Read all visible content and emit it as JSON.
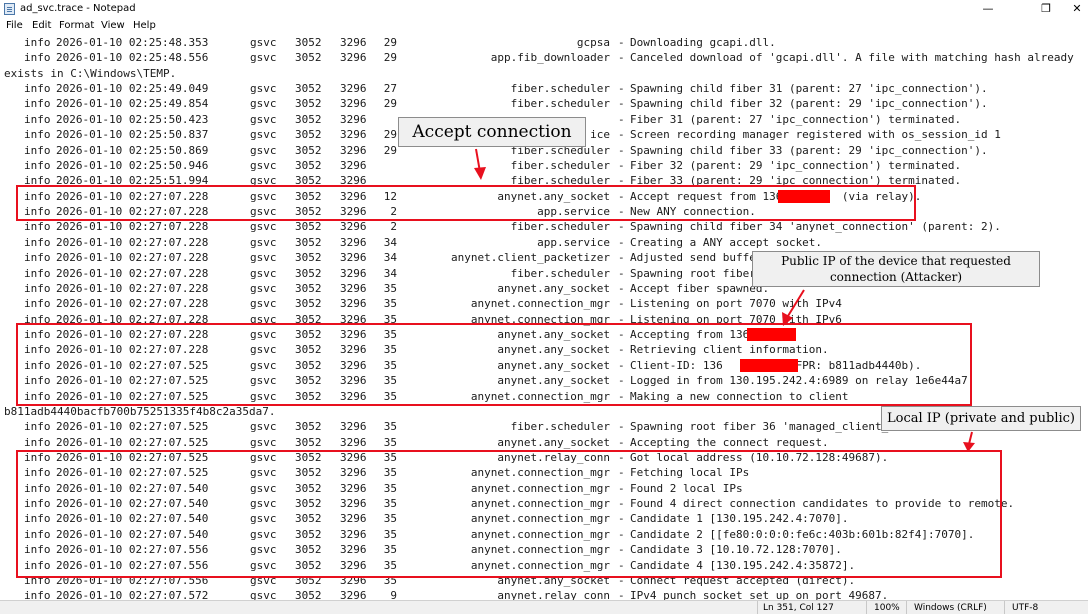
{
  "window": {
    "title": "ad_svc.trace - Notepad",
    "minimize_glyph": "—",
    "maximize_glyph": "❐",
    "close_glyph": "✕"
  },
  "menu": [
    "File",
    "Edit",
    "Format",
    "View",
    "Help"
  ],
  "log_lines": [
    {
      "lvl": "info",
      "ts": "2026-01-10 02:25:48.353",
      "proc": "gsvc",
      "pid": "3052",
      "tid": "3296",
      "n": "29",
      "src": "gcpsa",
      "msg": "Downloading gcapi.dll."
    },
    {
      "lvl": "info",
      "ts": "2026-01-10 02:25:48.556",
      "proc": "gsvc",
      "pid": "3052",
      "tid": "3296",
      "n": "29",
      "src": "app.fib_downloader",
      "msg": "Canceled download of 'gcapi.dll'. A file with matching hash already"
    },
    {
      "wrap": "exists in C:\\Windows\\TEMP."
    },
    {
      "lvl": "info",
      "ts": "2026-01-10 02:25:49.049",
      "proc": "gsvc",
      "pid": "3052",
      "tid": "3296",
      "n": "27",
      "src": "fiber.scheduler",
      "msg": "Spawning child fiber 31 (parent: 27 'ipc_connection')."
    },
    {
      "lvl": "info",
      "ts": "2026-01-10 02:25:49.854",
      "proc": "gsvc",
      "pid": "3052",
      "tid": "3296",
      "n": "29",
      "src": "fiber.scheduler",
      "msg": "Spawning child fiber 32 (parent: 29 'ipc_connection')."
    },
    {
      "lvl": "info",
      "ts": "2026-01-10 02:25:50.423",
      "proc": "gsvc",
      "pid": "3052",
      "tid": "3296",
      "n": "",
      "src": "",
      "msg": "Fiber 31 (parent: 27 'ipc_connection') terminated."
    },
    {
      "lvl": "info",
      "ts": "2026-01-10 02:25:50.837",
      "proc": "gsvc",
      "pid": "3052",
      "tid": "3296",
      "n": "29",
      "src": "ice",
      "msg": "Screen recording manager registered with os_session_id 1"
    },
    {
      "lvl": "info",
      "ts": "2026-01-10 02:25:50.869",
      "proc": "gsvc",
      "pid": "3052",
      "tid": "3296",
      "n": "29",
      "src": "fiber.scheduler",
      "msg": "Spawning child fiber 33 (parent: 29 'ipc_connection')."
    },
    {
      "lvl": "info",
      "ts": "2026-01-10 02:25:50.946",
      "proc": "gsvc",
      "pid": "3052",
      "tid": "3296",
      "n": "",
      "src": "fiber.scheduler",
      "msg": "Fiber 32 (parent: 29 'ipc_connection') terminated."
    },
    {
      "lvl": "info",
      "ts": "2026-01-10 02:25:51.994",
      "proc": "gsvc",
      "pid": "3052",
      "tid": "3296",
      "n": "",
      "src": "fiber.scheduler",
      "msg": "Fiber 33 (parent: 29 'ipc_connection') terminated."
    },
    {
      "lvl": "info",
      "ts": "2026-01-10 02:27:07.228",
      "proc": "gsvc",
      "pid": "3052",
      "tid": "3296",
      "n": "12",
      "src": "anynet.any_socket",
      "msg": "Accept request from 136         (via relay)."
    },
    {
      "lvl": "info",
      "ts": "2026-01-10 02:27:07.228",
      "proc": "gsvc",
      "pid": "3052",
      "tid": "3296",
      "n": "2",
      "src": "app.service",
      "msg": "New ANY connection."
    },
    {
      "lvl": "info",
      "ts": "2026-01-10 02:27:07.228",
      "proc": "gsvc",
      "pid": "3052",
      "tid": "3296",
      "n": "2",
      "src": "fiber.scheduler",
      "msg": "Spawning child fiber 34 'anynet_connection' (parent: 2)."
    },
    {
      "lvl": "info",
      "ts": "2026-01-10 02:27:07.228",
      "proc": "gsvc",
      "pid": "3052",
      "tid": "3296",
      "n": "34",
      "src": "app.service",
      "msg": "Creating a ANY accept socket."
    },
    {
      "lvl": "info",
      "ts": "2026-01-10 02:27:07.228",
      "proc": "gsvc",
      "pid": "3052",
      "tid": "3296",
      "n": "34",
      "src": "anynet.client_packetizer",
      "msg": "Adjusted send buffe"
    },
    {
      "lvl": "info",
      "ts": "2026-01-10 02:27:07.228",
      "proc": "gsvc",
      "pid": "3052",
      "tid": "3296",
      "n": "34",
      "src": "fiber.scheduler",
      "msg": "Spawning root fiber"
    },
    {
      "lvl": "info",
      "ts": "2026-01-10 02:27:07.228",
      "proc": "gsvc",
      "pid": "3052",
      "tid": "3296",
      "n": "35",
      "src": "anynet.any_socket",
      "msg": "Accept fiber spawned."
    },
    {
      "lvl": "info",
      "ts": "2026-01-10 02:27:07.228",
      "proc": "gsvc",
      "pid": "3052",
      "tid": "3296",
      "n": "35",
      "src": "anynet.connection_mgr",
      "msg": "Listening on port 7070 with IPv4"
    },
    {
      "lvl": "info",
      "ts": "2026-01-10 02:27:07.228",
      "proc": "gsvc",
      "pid": "3052",
      "tid": "3296",
      "n": "35",
      "src": "anynet.connection_mgr",
      "msg": "Listening on port 7070 with IPv6"
    },
    {
      "lvl": "info",
      "ts": "2026-01-10 02:27:07.228",
      "proc": "gsvc",
      "pid": "3052",
      "tid": "3296",
      "n": "35",
      "src": "anynet.any_socket",
      "msg": "Accepting from 136"
    },
    {
      "lvl": "info",
      "ts": "2026-01-10 02:27:07.228",
      "proc": "gsvc",
      "pid": "3052",
      "tid": "3296",
      "n": "35",
      "src": "anynet.any_socket",
      "msg": "Retrieving client information."
    },
    {
      "lvl": "info",
      "ts": "2026-01-10 02:27:07.525",
      "proc": "gsvc",
      "pid": "3052",
      "tid": "3296",
      "n": "35",
      "src": "anynet.any_socket",
      "msg": "Client-ID: 136          (FPR: b811adb4440b)."
    },
    {
      "lvl": "info",
      "ts": "2026-01-10 02:27:07.525",
      "proc": "gsvc",
      "pid": "3052",
      "tid": "3296",
      "n": "35",
      "src": "anynet.any_socket",
      "msg": "Logged in from 130.195.242.4:6989 on relay 1e6e44a7."
    },
    {
      "lvl": "info",
      "ts": "2026-01-10 02:27:07.525",
      "proc": "gsvc",
      "pid": "3052",
      "tid": "3296",
      "n": "35",
      "src": "anynet.connection_mgr",
      "msg": "Making a new connection to client"
    },
    {
      "wrap": "b811adb4440bacfb700b75251335f4b8c2a35da7."
    },
    {
      "lvl": "info",
      "ts": "2026-01-10 02:27:07.525",
      "proc": "gsvc",
      "pid": "3052",
      "tid": "3296",
      "n": "35",
      "src": "fiber.scheduler",
      "msg": "Spawning root fiber 36 'managed_client_"
    },
    {
      "lvl": "info",
      "ts": "2026-01-10 02:27:07.525",
      "proc": "gsvc",
      "pid": "3052",
      "tid": "3296",
      "n": "35",
      "src": "anynet.any_socket",
      "msg": "Accepting the connect request."
    },
    {
      "lvl": "info",
      "ts": "2026-01-10 02:27:07.525",
      "proc": "gsvc",
      "pid": "3052",
      "tid": "3296",
      "n": "35",
      "src": "anynet.relay_conn",
      "msg": "Got local address (10.10.72.128:49687)."
    },
    {
      "lvl": "info",
      "ts": "2026-01-10 02:27:07.525",
      "proc": "gsvc",
      "pid": "3052",
      "tid": "3296",
      "n": "35",
      "src": "anynet.connection_mgr",
      "msg": "Fetching local IPs"
    },
    {
      "lvl": "info",
      "ts": "2026-01-10 02:27:07.540",
      "proc": "gsvc",
      "pid": "3052",
      "tid": "3296",
      "n": "35",
      "src": "anynet.connection_mgr",
      "msg": "Found 2 local IPs"
    },
    {
      "lvl": "info",
      "ts": "2026-01-10 02:27:07.540",
      "proc": "gsvc",
      "pid": "3052",
      "tid": "3296",
      "n": "35",
      "src": "anynet.connection_mgr",
      "msg": "Found 4 direct connection candidates to provide to remote."
    },
    {
      "lvl": "info",
      "ts": "2026-01-10 02:27:07.540",
      "proc": "gsvc",
      "pid": "3052",
      "tid": "3296",
      "n": "35",
      "src": "anynet.connection_mgr",
      "msg": "Candidate 1 [130.195.242.4:7070]."
    },
    {
      "lvl": "info",
      "ts": "2026-01-10 02:27:07.540",
      "proc": "gsvc",
      "pid": "3052",
      "tid": "3296",
      "n": "35",
      "src": "anynet.connection_mgr",
      "msg": "Candidate 2 [[fe80:0:0:0:fe6c:403b:601b:82f4]:7070]."
    },
    {
      "lvl": "info",
      "ts": "2026-01-10 02:27:07.556",
      "proc": "gsvc",
      "pid": "3052",
      "tid": "3296",
      "n": "35",
      "src": "anynet.connection_mgr",
      "msg": "Candidate 3 [10.10.72.128:7070]."
    },
    {
      "lvl": "info",
      "ts": "2026-01-10 02:27:07.556",
      "proc": "gsvc",
      "pid": "3052",
      "tid": "3296",
      "n": "35",
      "src": "anynet.connection_mgr",
      "msg": "Candidate 4 [130.195.242.4:35872]."
    },
    {
      "lvl": "info",
      "ts": "2026-01-10 02:27:07.556",
      "proc": "gsvc",
      "pid": "3052",
      "tid": "3296",
      "n": "35",
      "src": "anynet.any_socket",
      "msg": "Connect request accepted (direct)."
    },
    {
      "lvl": "info",
      "ts": "2026-01-10 02:27:07.572",
      "proc": "gsvc",
      "pid": "3052",
      "tid": "3296",
      "n": "9",
      "src": "anynet.relay_conn",
      "msg": "IPv4 punch socket set up on port 49687."
    }
  ],
  "annotations": {
    "accept_connection": "Accept connection",
    "public_ip_line1": "Public IP of the device that requested",
    "public_ip_line2": "connection (Attacker)",
    "local_ip": "Local IP (private and public)"
  },
  "colors": {
    "highlight": "#e8101e",
    "redaction": "#ff0000"
  },
  "status": {
    "position": "Ln 351, Col 127",
    "zoom": "100%",
    "line_endings": "Windows (CRLF)",
    "encoding": "UTF-8"
  }
}
